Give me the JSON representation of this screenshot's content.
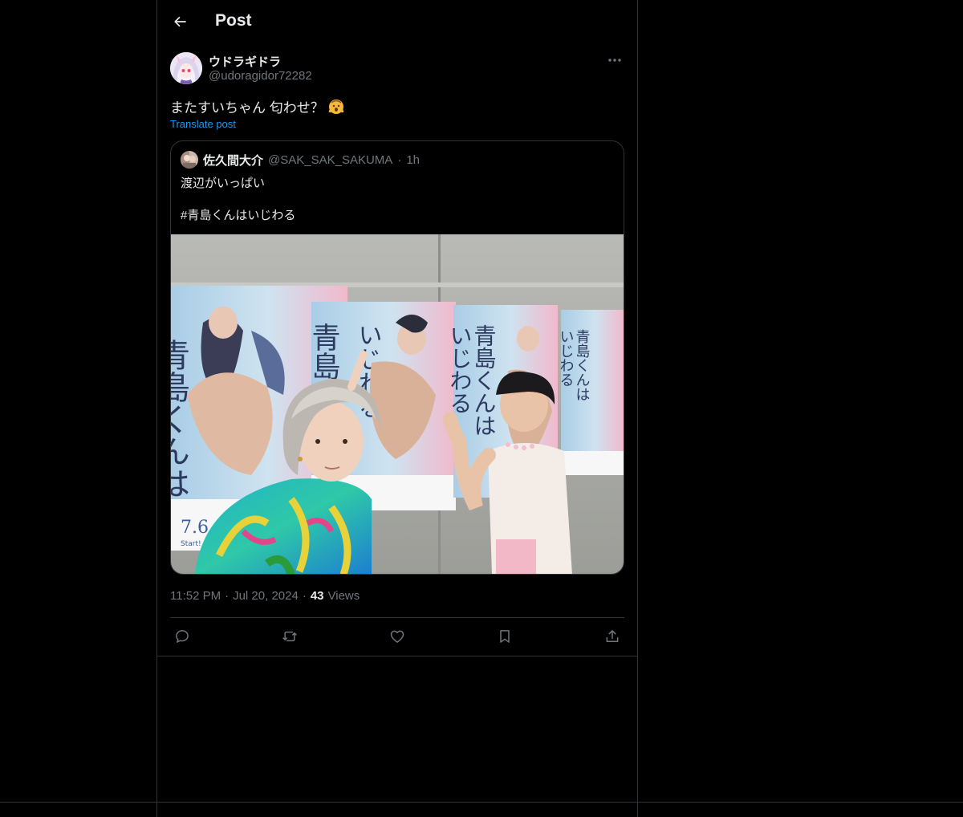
{
  "header": {
    "title": "Post",
    "back_icon": "arrow-left-icon"
  },
  "author": {
    "name": "ウドラギドラ",
    "handle": "@udoragidor72282",
    "more_icon": "more-horizontal-icon"
  },
  "post": {
    "text": "またすいちゃん 匂わせ？",
    "emoji": "shushing-face-emoji",
    "translate_label": "Translate post"
  },
  "quote": {
    "name": "佐久間大介",
    "handle": "@SAK_SAK_SAKUMA",
    "separator": "·",
    "time": "1h",
    "line1": "渡辺がいっぱい",
    "line2": "#青島くんはいじわる",
    "media": {
      "poster_title": "青島くんはいじわる",
      "poster_date": "7.6",
      "poster_start": "Start!"
    }
  },
  "meta": {
    "time": "11:52 PM",
    "dot1": "·",
    "date": "Jul 20, 2024",
    "dot2": "·",
    "views_count": "43",
    "views_label": "Views"
  },
  "actions": [
    {
      "icon": "reply-icon"
    },
    {
      "icon": "repost-icon"
    },
    {
      "icon": "like-icon"
    },
    {
      "icon": "bookmark-icon"
    },
    {
      "icon": "share-icon"
    }
  ],
  "colors": {
    "background": "#000000",
    "text": "#e7e9ea",
    "muted": "#71767b",
    "border": "#2f3336",
    "accent": "#1d9bf0"
  }
}
